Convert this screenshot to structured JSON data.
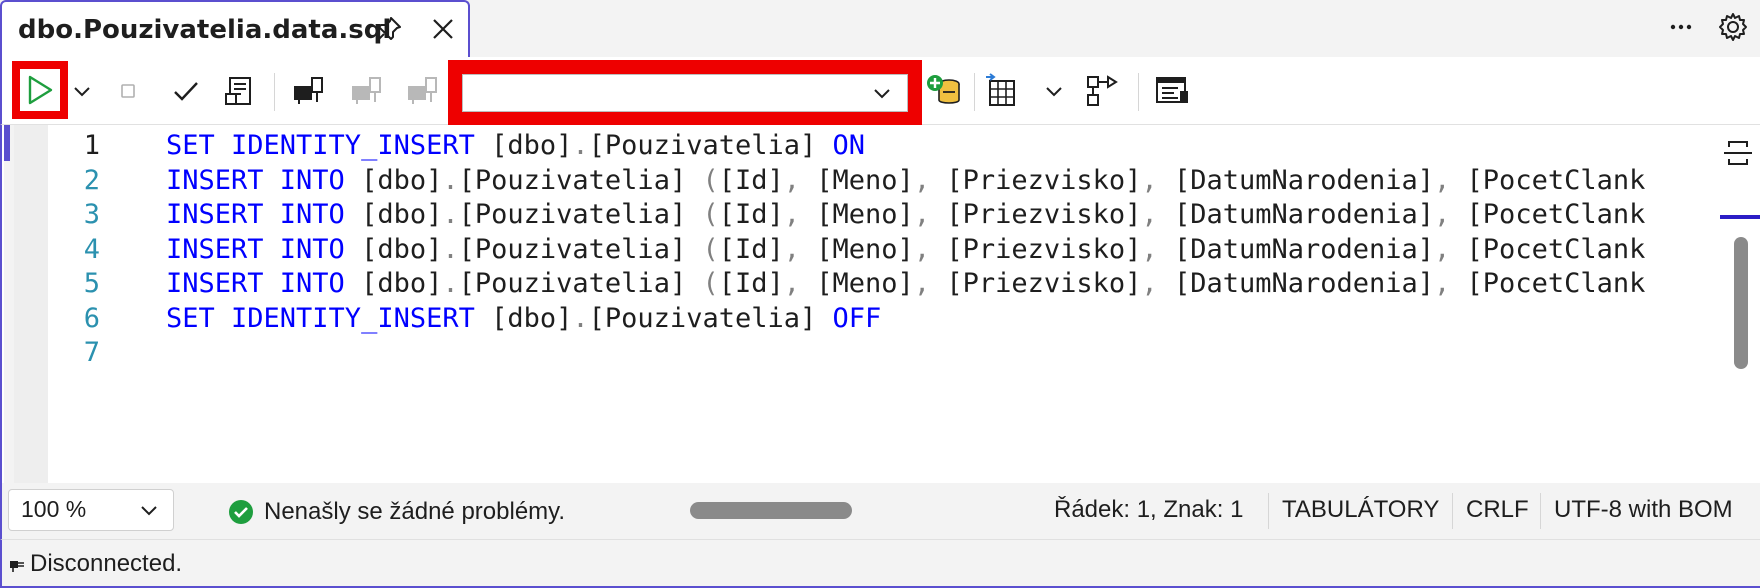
{
  "tab": {
    "title": "dbo.Pouzivatelia.data.sql",
    "pin_icon": "pin-icon",
    "close_icon": "close-icon"
  },
  "window": {
    "more_icon": "ellipsis-icon",
    "settings_icon": "gear-icon"
  },
  "toolbar": {
    "database_value": "",
    "buttons": [
      "execute",
      "execute-dropdown",
      "stop",
      "parse",
      "estimated-plan",
      "connect",
      "disconnect",
      "change-connection",
      "new-query",
      "results-to",
      "results-dropdown",
      "actual-plan",
      "sqlcmd-mode"
    ]
  },
  "editor": {
    "lines": [
      {
        "number": "1",
        "tokens": [
          [
            "kw",
            "SET IDENTITY_INSERT "
          ],
          [
            "id",
            "[dbo]"
          ],
          [
            "pn",
            "."
          ],
          [
            "id",
            "[Pouzivatelia]"
          ],
          [
            "id",
            " "
          ],
          [
            "kw",
            "ON"
          ]
        ]
      },
      {
        "number": "2",
        "tokens": [
          [
            "kw",
            "INSERT INTO "
          ],
          [
            "id",
            "[dbo]"
          ],
          [
            "pn",
            "."
          ],
          [
            "id",
            "[Pouzivatelia] "
          ],
          [
            "pn",
            "("
          ],
          [
            "id",
            "[Id]"
          ],
          [
            "pn",
            ", "
          ],
          [
            "id",
            "[Meno]"
          ],
          [
            "pn",
            ", "
          ],
          [
            "id",
            "[Priezvisko]"
          ],
          [
            "pn",
            ", "
          ],
          [
            "id",
            "[DatumNarodenia]"
          ],
          [
            "pn",
            ", "
          ],
          [
            "id",
            "[PocetClank"
          ]
        ]
      },
      {
        "number": "3",
        "tokens": [
          [
            "kw",
            "INSERT INTO "
          ],
          [
            "id",
            "[dbo]"
          ],
          [
            "pn",
            "."
          ],
          [
            "id",
            "[Pouzivatelia] "
          ],
          [
            "pn",
            "("
          ],
          [
            "id",
            "[Id]"
          ],
          [
            "pn",
            ", "
          ],
          [
            "id",
            "[Meno]"
          ],
          [
            "pn",
            ", "
          ],
          [
            "id",
            "[Priezvisko]"
          ],
          [
            "pn",
            ", "
          ],
          [
            "id",
            "[DatumNarodenia]"
          ],
          [
            "pn",
            ", "
          ],
          [
            "id",
            "[PocetClank"
          ]
        ]
      },
      {
        "number": "4",
        "tokens": [
          [
            "kw",
            "INSERT INTO "
          ],
          [
            "id",
            "[dbo]"
          ],
          [
            "pn",
            "."
          ],
          [
            "id",
            "[Pouzivatelia] "
          ],
          [
            "pn",
            "("
          ],
          [
            "id",
            "[Id]"
          ],
          [
            "pn",
            ", "
          ],
          [
            "id",
            "[Meno]"
          ],
          [
            "pn",
            ", "
          ],
          [
            "id",
            "[Priezvisko]"
          ],
          [
            "pn",
            ", "
          ],
          [
            "id",
            "[DatumNarodenia]"
          ],
          [
            "pn",
            ", "
          ],
          [
            "id",
            "[PocetClank"
          ]
        ]
      },
      {
        "number": "5",
        "tokens": [
          [
            "kw",
            "INSERT INTO "
          ],
          [
            "id",
            "[dbo]"
          ],
          [
            "pn",
            "."
          ],
          [
            "id",
            "[Pouzivatelia] "
          ],
          [
            "pn",
            "("
          ],
          [
            "id",
            "[Id]"
          ],
          [
            "pn",
            ", "
          ],
          [
            "id",
            "[Meno]"
          ],
          [
            "pn",
            ", "
          ],
          [
            "id",
            "[Priezvisko]"
          ],
          [
            "pn",
            ", "
          ],
          [
            "id",
            "[DatumNarodenia]"
          ],
          [
            "pn",
            ", "
          ],
          [
            "id",
            "[PocetClank"
          ]
        ]
      },
      {
        "number": "6",
        "tokens": [
          [
            "kw",
            "SET IDENTITY_INSERT "
          ],
          [
            "id",
            "[dbo]"
          ],
          [
            "pn",
            "."
          ],
          [
            "id",
            "[Pouzivatelia]"
          ],
          [
            "id",
            " "
          ],
          [
            "kw",
            "OFF"
          ]
        ]
      },
      {
        "number": "7",
        "tokens": []
      }
    ]
  },
  "status": {
    "zoom": "100 %",
    "issues": "Nenašly se žádné problémy.",
    "position": "Řádek: 1, Znak: 1",
    "indent": "TABULÁTORY",
    "line_ending": "CRLF",
    "encoding": "UTF-8 with BOM"
  },
  "connection": {
    "status": "Disconnected."
  },
  "colors": {
    "accent": "#5b4fcf",
    "keyword": "#0000ff",
    "line_number": "#2b91af",
    "highlight": "#ee0000",
    "ok": "#1e9e3e"
  }
}
